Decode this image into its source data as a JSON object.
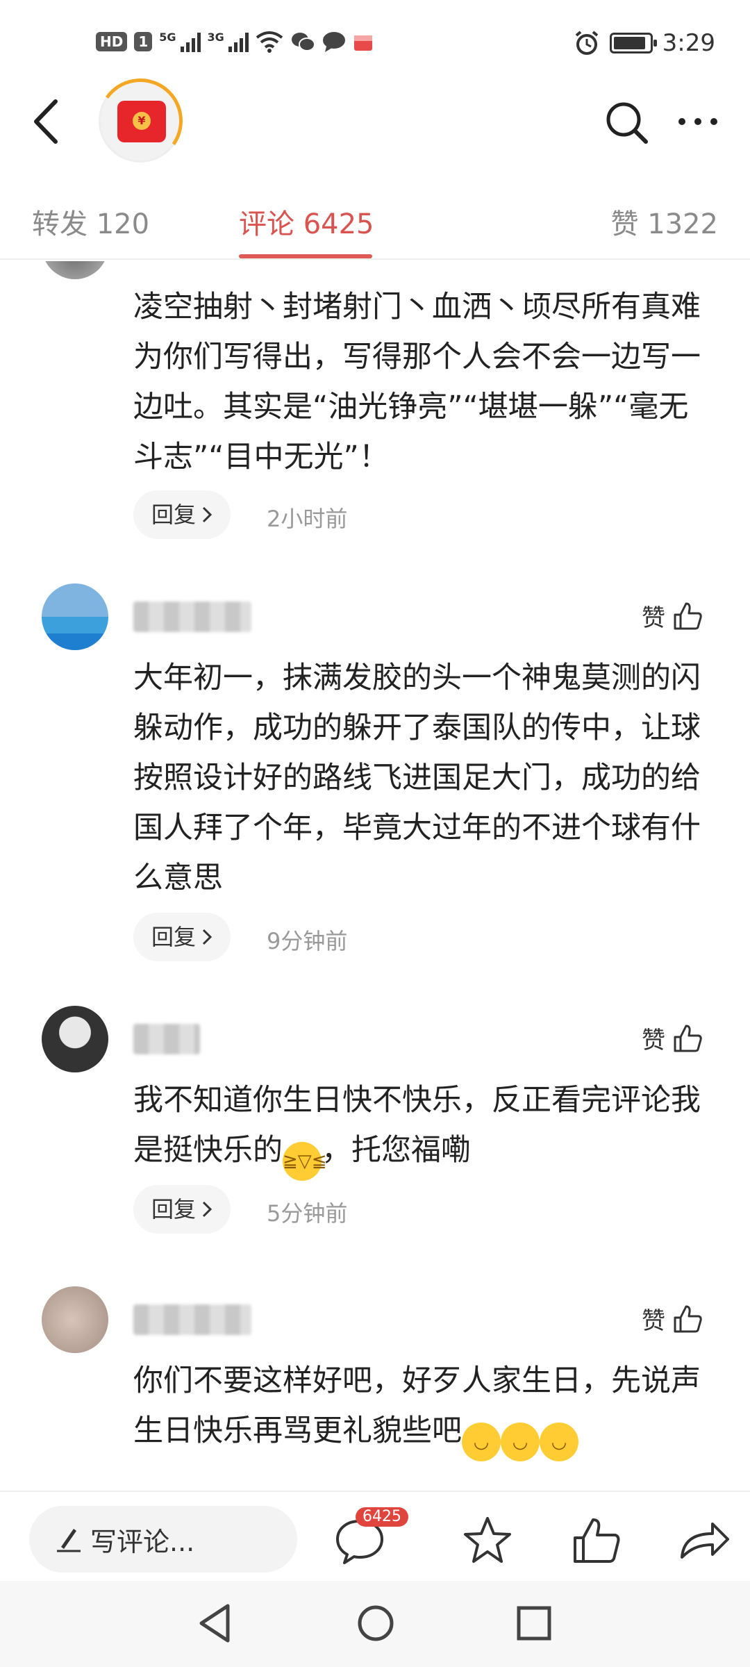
{
  "status_bar": {
    "hd": "HD",
    "sim": "1",
    "net1": "5G",
    "net2": "3G",
    "time": "3:29",
    "battery_level": 0.9
  },
  "header": {
    "avatar_symbol": "¥"
  },
  "tabs": {
    "forward": "转发 120",
    "comments": "评论 6425",
    "likes": "赞 1322"
  },
  "comments": [
    {
      "text": "凌空抽射丶封堵射门丶血洒丶顷尽所有真难为你们写得出，写得那个人会不会一边写一边吐。其实是“油光铮亮”“堪堪一躲”“毫无斗志”“目中无光”！",
      "reply_label": "回复",
      "time": "2小时前"
    },
    {
      "like_label": "赞",
      "text": "大年初一，抹满发胶的头一个神鬼莫测的闪躲动作，成功的躲开了泰国队的传中，让球按照设计好的路线飞进国足大门，成功的给国人拜了个年，毕竟大过年的不进个球有什么意思",
      "reply_label": "回复",
      "time": "9分钟前"
    },
    {
      "like_label": "赞",
      "text_before": "我不知道你生日快不快乐，反正看完评论我是挺快乐的",
      "text_after": "，托您福嘞",
      "reply_label": "回复",
      "time": "5分钟前"
    },
    {
      "like_label": "赞",
      "text": "你们不要这样好吧，好歹人家生日，先说声生日快乐再骂更礼貌些吧"
    }
  ],
  "bottom_bar": {
    "write_placeholder": "写评论...",
    "comment_count_badge": "6425"
  }
}
